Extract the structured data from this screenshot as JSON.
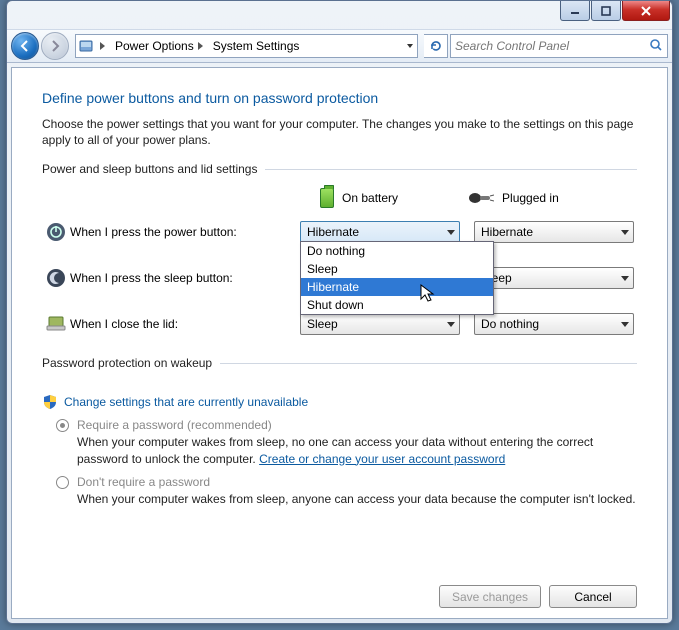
{
  "window_controls": {
    "minimize": "minimize",
    "maximize": "maximize",
    "close": "close"
  },
  "breadcrumb": {
    "root_icon": "control-panel-icon",
    "items": [
      "Power Options",
      "System Settings"
    ]
  },
  "search": {
    "placeholder": "Search Control Panel"
  },
  "heading": "Define power buttons and turn on password protection",
  "description": "Choose the power settings that you want for your computer. The changes you make to the settings on this page apply to all of your power plans.",
  "group1_label": "Power and sleep buttons and lid settings",
  "columns": {
    "battery": "On battery",
    "plugged": "Plugged in"
  },
  "rows": [
    {
      "label": "When I press the power button:",
      "battery": "Hibernate",
      "plugged": "Hibernate"
    },
    {
      "label": "When I press the sleep button:",
      "battery": "",
      "plugged": "Sleep"
    },
    {
      "label": "When I close the lid:",
      "battery": "Sleep",
      "plugged": "Do nothing"
    }
  ],
  "dropdown": {
    "options": [
      "Do nothing",
      "Sleep",
      "Hibernate",
      "Shut down"
    ],
    "highlighted_index": 2
  },
  "group2_label": "Password protection on wakeup",
  "change_unavailable": "Change settings that are currently unavailable",
  "radios": {
    "require": {
      "title": "Require a password (recommended)",
      "desc_before": "When your computer wakes from sleep, no one can access your data without entering the correct password to unlock the computer. ",
      "link": "Create or change your user account password"
    },
    "dont": {
      "title": "Don't require a password",
      "desc": "When your computer wakes from sleep, anyone can access your data because the computer isn't locked."
    }
  },
  "buttons": {
    "save": "Save changes",
    "cancel": "Cancel"
  }
}
